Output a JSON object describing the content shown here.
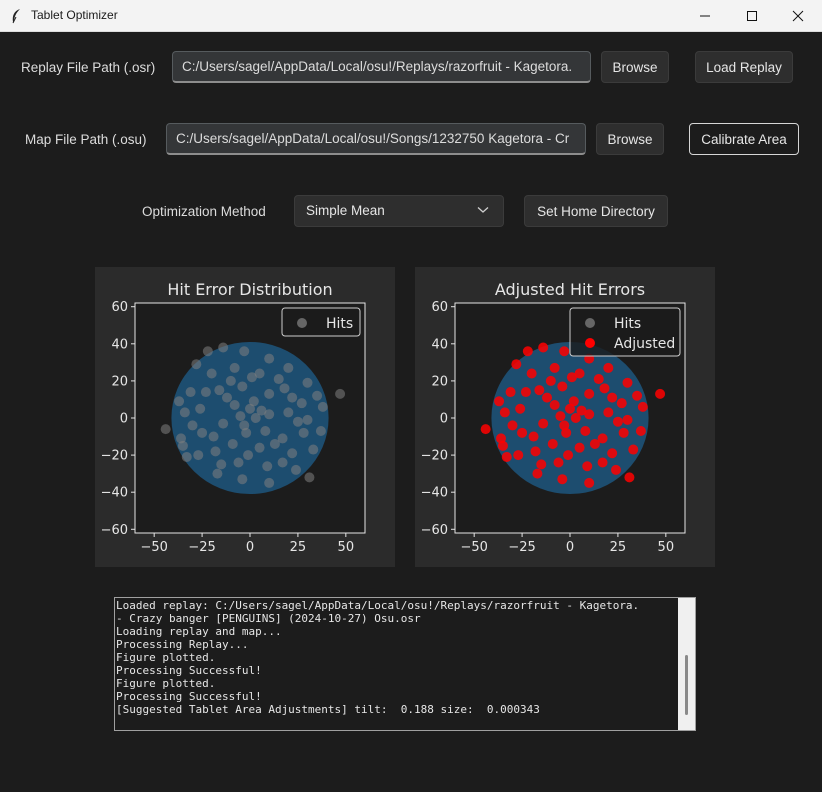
{
  "window": {
    "title": "Tablet Optimizer",
    "controls": [
      "minimize-icon",
      "maximize-icon",
      "close-icon"
    ]
  },
  "replay": {
    "label": "Replay File Path (.osr)",
    "value": "C:/Users/sagel/AppData/Local/osu!/Replays/razorfruit - Kagetora.",
    "browse_label": "Browse",
    "load_label": "Load Replay"
  },
  "map": {
    "label": "Map File Path (.osu)",
    "value": "C:/Users/sagel/AppData/Local/osu!/Songs/1232750 Kagetora - Cr",
    "browse_label": "Browse",
    "calibrate_label": "Calibrate Area"
  },
  "optimization": {
    "label": "Optimization Method",
    "selected": "Simple Mean",
    "home_label": "Set Home Directory"
  },
  "colors": {
    "background": "#1c1c1c",
    "plot_background": "#2b2b2b",
    "circle_fill": "#1f77b4",
    "hits": "#808080",
    "adjusted": "#ff0000"
  },
  "chart_data": [
    {
      "type": "scatter",
      "title": "Hit Error Distribution",
      "xlim": [
        -60,
        60
      ],
      "ylim": [
        -62,
        62
      ],
      "xticks": [
        -50,
        -25,
        0,
        25,
        50
      ],
      "yticks": [
        -60,
        -40,
        -20,
        0,
        20,
        40,
        60
      ],
      "legend": "top-right",
      "circle_radius": 41,
      "series": [
        {
          "name": "Hits",
          "color": "#808080",
          "alpha": 0.55,
          "points": [
            [
              -44,
              -6
            ],
            [
              47,
              13
            ],
            [
              31,
              -32
            ],
            [
              -37,
              9
            ],
            [
              -36,
              -11
            ],
            [
              -33,
              -21
            ],
            [
              -28,
              29
            ],
            [
              -22,
              36
            ],
            [
              -14,
              38
            ],
            [
              -3,
              36
            ],
            [
              10,
              32
            ],
            [
              20,
              27
            ],
            [
              30,
              19
            ],
            [
              38,
              6
            ],
            [
              37,
              -7
            ],
            [
              33,
              -17
            ],
            [
              24,
              -28
            ],
            [
              10,
              -35
            ],
            [
              -4,
              -33
            ],
            [
              -17,
              -30
            ],
            [
              -27,
              -20
            ],
            [
              -34,
              3
            ],
            [
              -31,
              14
            ],
            [
              -20,
              24
            ],
            [
              -8,
              27
            ],
            [
              5,
              24
            ],
            [
              18,
              16
            ],
            [
              27,
              8
            ],
            [
              28,
              -8
            ],
            [
              22,
              -19
            ],
            [
              9,
              -26
            ],
            [
              -6,
              -24
            ],
            [
              -18,
              -18
            ],
            [
              -25,
              -8
            ],
            [
              -26,
              5
            ],
            [
              -16,
              15
            ],
            [
              -4,
              17
            ],
            [
              10,
              13
            ],
            [
              20,
              3
            ],
            [
              17,
              -11
            ],
            [
              5,
              -16
            ],
            [
              -9,
              -14
            ],
            [
              -14,
              -3
            ],
            [
              -8,
              7
            ],
            [
              2,
              9
            ],
            [
              10,
              2
            ],
            [
              8,
              -7
            ],
            [
              -2,
              -8
            ],
            [
              -5,
              1
            ],
            [
              3,
              0
            ],
            [
              0,
              5
            ],
            [
              -3,
              -4
            ],
            [
              6,
              4
            ],
            [
              -12,
              11
            ],
            [
              13,
              -14
            ],
            [
              -19,
              -10
            ],
            [
              22,
              11
            ],
            [
              -10,
              20
            ],
            [
              15,
              21
            ],
            [
              -23,
              14
            ],
            [
              25,
              -2
            ],
            [
              -1,
              -20
            ],
            [
              1,
              22
            ],
            [
              -30,
              -4
            ],
            [
              30,
              -1
            ],
            [
              -15,
              -25
            ],
            [
              17,
              -24
            ],
            [
              -35,
              -15
            ],
            [
              35,
              12
            ]
          ]
        }
      ]
    },
    {
      "type": "scatter",
      "title": "Adjusted Hit Errors",
      "xlim": [
        -60,
        60
      ],
      "ylim": [
        -62,
        62
      ],
      "xticks": [
        -50,
        -25,
        0,
        25,
        50
      ],
      "yticks": [
        -60,
        -40,
        -20,
        0,
        20,
        40,
        60
      ],
      "legend": "top-right",
      "circle_radius": 41,
      "series": [
        {
          "name": "Hits",
          "color": "#808080",
          "alpha": 0.55,
          "points": []
        },
        {
          "name": "Adjusted",
          "color": "#ff0000",
          "alpha": 0.85,
          "points": [
            [
              -44,
              -6
            ],
            [
              47,
              13
            ],
            [
              31,
              -32
            ],
            [
              -37,
              9
            ],
            [
              -36,
              -11
            ],
            [
              -33,
              -21
            ],
            [
              -28,
              29
            ],
            [
              -22,
              36
            ],
            [
              -14,
              38
            ],
            [
              -3,
              36
            ],
            [
              10,
              32
            ],
            [
              20,
              27
            ],
            [
              30,
              19
            ],
            [
              38,
              6
            ],
            [
              37,
              -7
            ],
            [
              33,
              -17
            ],
            [
              24,
              -28
            ],
            [
              10,
              -35
            ],
            [
              -4,
              -33
            ],
            [
              -17,
              -30
            ],
            [
              -27,
              -20
            ],
            [
              -34,
              3
            ],
            [
              -31,
              14
            ],
            [
              -20,
              24
            ],
            [
              -8,
              27
            ],
            [
              5,
              24
            ],
            [
              18,
              16
            ],
            [
              27,
              8
            ],
            [
              28,
              -8
            ],
            [
              22,
              -19
            ],
            [
              9,
              -26
            ],
            [
              -6,
              -24
            ],
            [
              -18,
              -18
            ],
            [
              -25,
              -8
            ],
            [
              -26,
              5
            ],
            [
              -16,
              15
            ],
            [
              -4,
              17
            ],
            [
              10,
              13
            ],
            [
              20,
              3
            ],
            [
              17,
              -11
            ],
            [
              5,
              -16
            ],
            [
              -9,
              -14
            ],
            [
              -14,
              -3
            ],
            [
              -8,
              7
            ],
            [
              2,
              9
            ],
            [
              10,
              2
            ],
            [
              8,
              -7
            ],
            [
              -2,
              -8
            ],
            [
              -5,
              1
            ],
            [
              3,
              0
            ],
            [
              0,
              5
            ],
            [
              -3,
              -4
            ],
            [
              6,
              4
            ],
            [
              -12,
              11
            ],
            [
              13,
              -14
            ],
            [
              -19,
              -10
            ],
            [
              22,
              11
            ],
            [
              -10,
              20
            ],
            [
              15,
              21
            ],
            [
              -23,
              14
            ],
            [
              25,
              -2
            ],
            [
              -1,
              -20
            ],
            [
              1,
              22
            ],
            [
              -30,
              -4
            ],
            [
              30,
              -1
            ],
            [
              -15,
              -25
            ],
            [
              17,
              -24
            ],
            [
              -35,
              -15
            ],
            [
              35,
              12
            ]
          ]
        }
      ]
    }
  ],
  "console": {
    "lines": [
      "Loaded replay: C:/Users/sagel/AppData/Local/osu!/Replays/razorfruit - Kagetora.",
      "- Crazy banger [PENGUINS] (2024-10-27) Osu.osr",
      "Loading replay and map...",
      "Processing Replay...",
      "Figure plotted.",
      "Processing Successful!",
      "Figure plotted.",
      "Processing Successful!",
      "[Suggested Tablet Area Adjustments] tilt:  0.188 size:  0.000343"
    ]
  }
}
